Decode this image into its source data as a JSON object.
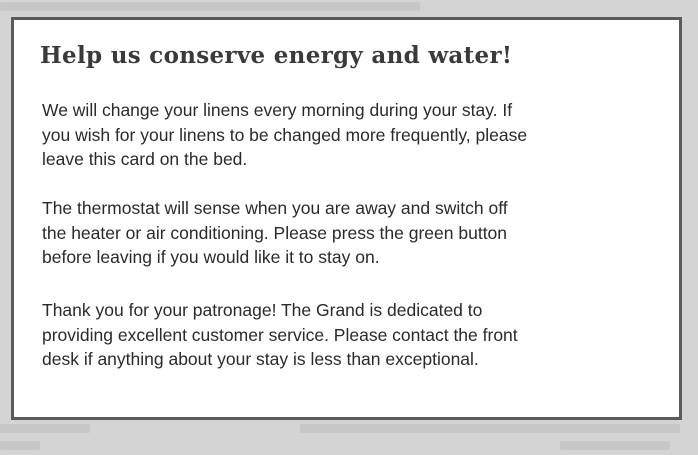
{
  "card": {
    "title": "Help us conserve energy and water!",
    "paragraphs": [
      {
        "lines": [
          "We will change your linens every morning during your stay. If",
          "you wish for your linens to be changed more frequently, please",
          "leave this card on the bed."
        ]
      },
      {
        "lines": [
          "The thermostat will sense when you are away and switch off",
          "the heater or air conditioning. Please press the green button",
          "before leaving if you would like it to stay on."
        ]
      },
      {
        "lines": [
          "Thank you for your patronage! The Grand is dedicated to",
          "providing excellent customer service. Please contact the front",
          "desk if anything about your stay is less than exceptional."
        ]
      }
    ]
  }
}
